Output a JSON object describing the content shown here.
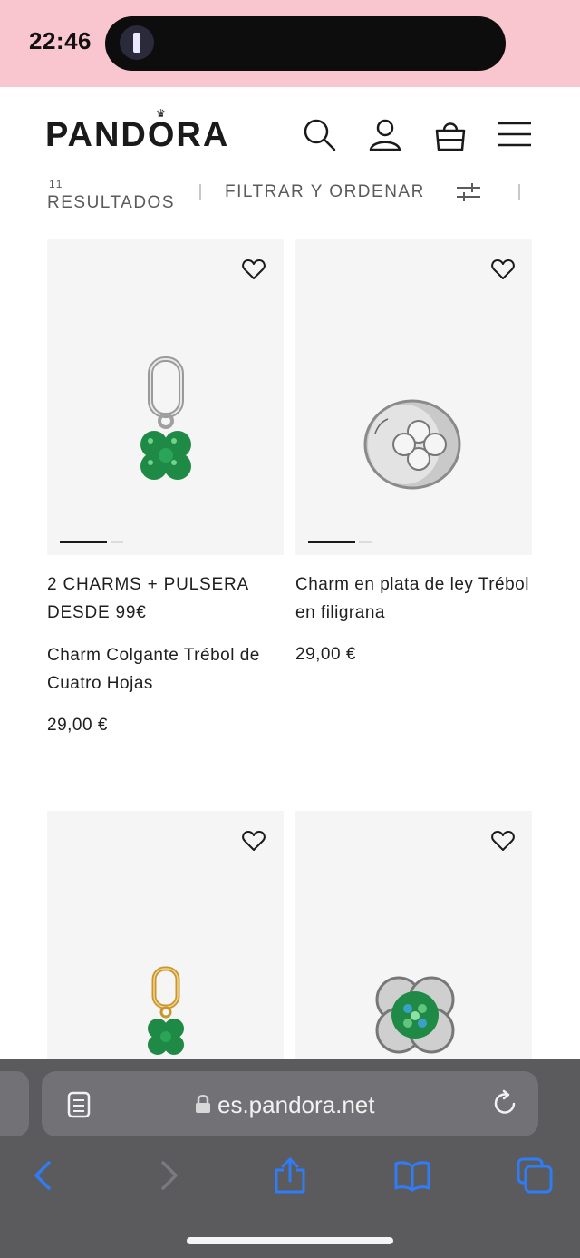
{
  "status_bar": {
    "time": "22:46"
  },
  "header": {
    "logo": "PANDORA",
    "icons": [
      "search-icon",
      "account-icon",
      "bag-icon",
      "menu-icon"
    ]
  },
  "toolbar": {
    "results_count": "11",
    "results_label": "RESULTADOS",
    "filter_label": "FILTRAR Y ORDENAR"
  },
  "products": [
    {
      "promo": "2 CHARMS + PULSERA DESDE 99€",
      "name": "Charm Colgante Trébol de Cuatro Hojas",
      "price": "29,00 €"
    },
    {
      "promo": "",
      "name": "Charm en plata de ley Trébol en filigrana",
      "price": "29,00 €"
    },
    {
      "promo": "",
      "name": "",
      "price": ""
    },
    {
      "promo": "",
      "name": "",
      "price": ""
    }
  ],
  "browser": {
    "url": "es.pandora.net",
    "icons": [
      "reader-icon",
      "lock-icon",
      "reload-icon",
      "back-icon",
      "forward-icon",
      "share-icon",
      "bookmarks-icon",
      "tabs-icon"
    ]
  },
  "colors": {
    "status_bar_bg": "#f9c6cf",
    "image_bg": "#f5f5f5",
    "toolbar_bg": "#5b5b5e",
    "ios_blue": "#2f7cf6",
    "clover_green": "#1f8a45"
  }
}
